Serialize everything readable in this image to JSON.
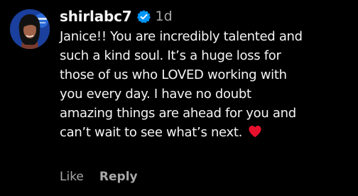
{
  "comment": {
    "username": "shirlabc7",
    "verified_icon": "verified-badge-icon",
    "timestamp": "1d",
    "avatar_icon": "profile-avatar",
    "text_lines": [
      "Janice!! You are incredibly talented and",
      "such a kind soul. It’s a huge loss for",
      "those of us who LOVED working with",
      "you every day. I have no doubt",
      "amazing things are ahead for you and",
      "can’t wait to see what’s next."
    ],
    "emoji_icon": "red-heart-icon",
    "actions": {
      "like_label": "Like",
      "reply_label": "Reply"
    }
  },
  "colors": {
    "background": "#000000",
    "text": "#f5f5f5",
    "secondary_text": "#a8a8a8",
    "verified_blue": "#0095f6",
    "heart_red": "#e8112d"
  }
}
